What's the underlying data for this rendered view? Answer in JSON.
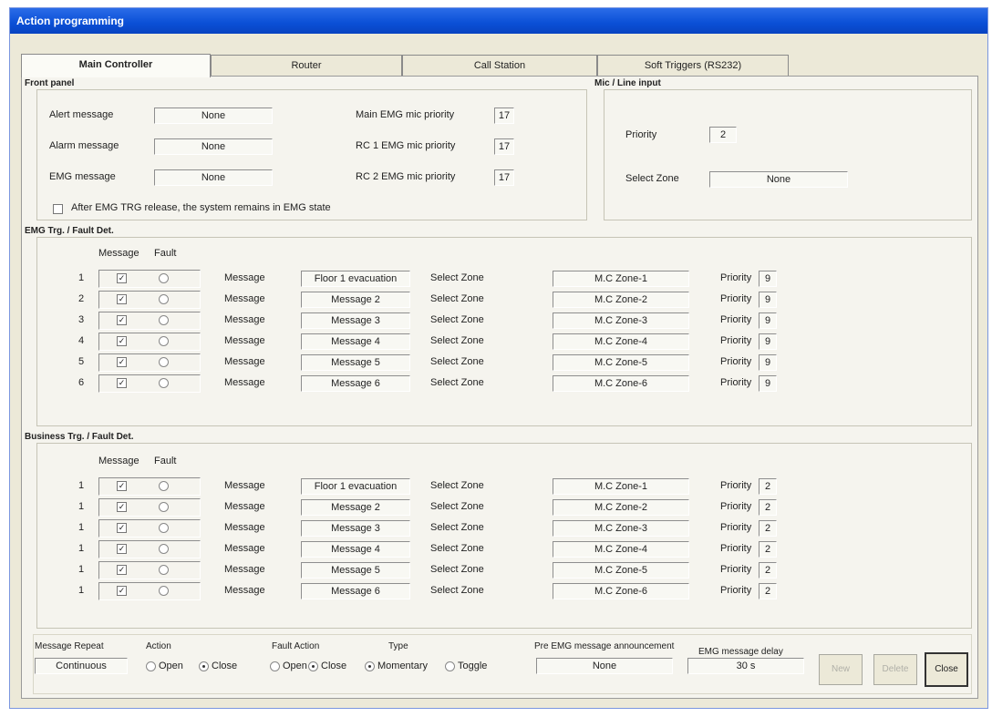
{
  "window": {
    "title": "Action programming"
  },
  "tabs": [
    "Main Controller",
    "Router",
    "Call Station",
    "Soft Triggers (RS232)"
  ],
  "front_panel": {
    "title": "Front panel",
    "alert_label": "Alert message",
    "alert_value": "None",
    "alarm_label": "Alarm message",
    "alarm_value": "None",
    "emg_label": "EMG message",
    "emg_value": "None",
    "main_emg_label": "Main EMG mic priority",
    "main_emg_value": "17",
    "rc1_label": "RC 1 EMG mic priority",
    "rc1_value": "17",
    "rc2_label": "RC 2 EMG mic priority",
    "rc2_value": "17",
    "after_emg_label": "After EMG TRG release, the system remains in EMG state"
  },
  "mic_line": {
    "title": "Mic / Line input",
    "priority_label": "Priority",
    "priority_value": "2",
    "zone_label": "Select Zone",
    "zone_value": "None"
  },
  "emg": {
    "title": "EMG Trg. / Fault Det.",
    "col_message": "Message",
    "col_fault": "Fault",
    "rows": [
      {
        "num": "1",
        "msg_label": "Message",
        "message": "Floor 1 evacuation",
        "zone_label": "Select Zone",
        "zone": "M.C Zone-1",
        "prio_label": "Priority",
        "priority": "9"
      },
      {
        "num": "2",
        "msg_label": "Message",
        "message": "Message 2",
        "zone_label": "Select Zone",
        "zone": "M.C Zone-2",
        "prio_label": "Priority",
        "priority": "9"
      },
      {
        "num": "3",
        "msg_label": "Message",
        "message": "Message 3",
        "zone_label": "Select Zone",
        "zone": "M.C Zone-3",
        "prio_label": "Priority",
        "priority": "9"
      },
      {
        "num": "4",
        "msg_label": "Message",
        "message": "Message 4",
        "zone_label": "Select Zone",
        "zone": "M.C Zone-4",
        "prio_label": "Priority",
        "priority": "9"
      },
      {
        "num": "5",
        "msg_label": "Message",
        "message": "Message 5",
        "zone_label": "Select Zone",
        "zone": "M.C Zone-5",
        "prio_label": "Priority",
        "priority": "9"
      },
      {
        "num": "6",
        "msg_label": "Message",
        "message": "Message 6",
        "zone_label": "Select Zone",
        "zone": "M.C Zone-6",
        "prio_label": "Priority",
        "priority": "9"
      }
    ]
  },
  "business": {
    "title": "Business Trg. / Fault Det.",
    "col_message": "Message",
    "col_fault": "Fault",
    "rows": [
      {
        "num": "1",
        "msg_label": "Message",
        "message": "Floor 1 evacuation",
        "zone_label": "Select Zone",
        "zone": "M.C Zone-1",
        "prio_label": "Priority",
        "priority": "2"
      },
      {
        "num": "1",
        "msg_label": "Message",
        "message": "Message 2",
        "zone_label": "Select Zone",
        "zone": "M.C Zone-2",
        "prio_label": "Priority",
        "priority": "2"
      },
      {
        "num": "1",
        "msg_label": "Message",
        "message": "Message 3",
        "zone_label": "Select Zone",
        "zone": "M.C Zone-3",
        "prio_label": "Priority",
        "priority": "2"
      },
      {
        "num": "1",
        "msg_label": "Message",
        "message": "Message 4",
        "zone_label": "Select Zone",
        "zone": "M.C Zone-4",
        "prio_label": "Priority",
        "priority": "2"
      },
      {
        "num": "1",
        "msg_label": "Message",
        "message": "Message 5",
        "zone_label": "Select Zone",
        "zone": "M.C Zone-5",
        "prio_label": "Priority",
        "priority": "2"
      },
      {
        "num": "1",
        "msg_label": "Message",
        "message": "Message 6",
        "zone_label": "Select Zone",
        "zone": "M.C Zone-6",
        "prio_label": "Priority",
        "priority": "2"
      }
    ]
  },
  "bottom": {
    "repeat_label": "Message Repeat",
    "repeat_value": "Continuous",
    "action_label": "Action",
    "open_label": "Open",
    "close_label": "Close",
    "fault_action_label": "Fault Action",
    "fa_open_label": "Open",
    "fa_close_label": "Close",
    "type_label": "Type",
    "momentary_label": "Momentary",
    "toggle_label": "Toggle",
    "pre_emg_label": "Pre EMG message announcement",
    "pre_emg_value": "None",
    "delay_label": "EMG message delay",
    "delay_value": "30 s",
    "btn_new": "New",
    "btn_delete": "Delete",
    "btn_close": "Close"
  }
}
